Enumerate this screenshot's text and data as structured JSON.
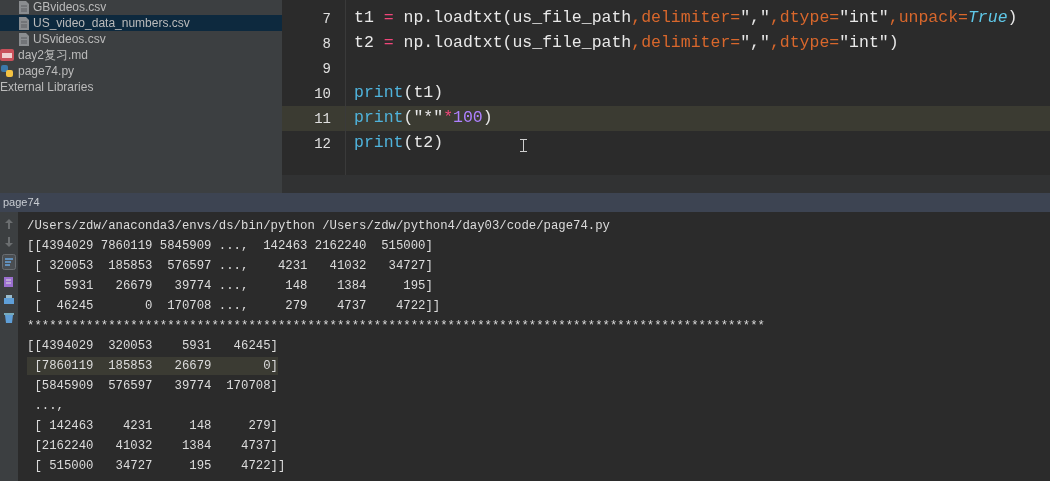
{
  "project_tree": {
    "folder_files": [
      {
        "label": "GBvideos.csv",
        "selected": false
      },
      {
        "label": "US_video_data_numbers.csv",
        "selected": true
      },
      {
        "label": "USvideos.csv",
        "selected": false
      }
    ],
    "files": [
      {
        "label": "day2复习.md",
        "kind": "markdown",
        "selected": false
      },
      {
        "label": "page74.py",
        "kind": "python",
        "selected": false
      }
    ],
    "root_items": [
      {
        "label": "External Libraries",
        "selected": false
      }
    ]
  },
  "editor": {
    "lines": [
      {
        "number": "7",
        "current": false,
        "tokens": [
          {
            "kind": "plain",
            "text": "t1 "
          },
          {
            "kind": "op",
            "text": "="
          },
          {
            "kind": "plain",
            "text": " np.loadtxt(us_file_path"
          },
          {
            "kind": "kwarg",
            "text": ",delimiter="
          },
          {
            "kind": "string",
            "text": "\",\""
          },
          {
            "kind": "kwarg",
            "text": ",dtype="
          },
          {
            "kind": "string",
            "text": "\"int\""
          },
          {
            "kind": "kwarg",
            "text": ",unpack="
          },
          {
            "kind": "keyword",
            "text": "True"
          },
          {
            "kind": "plain",
            "text": ")"
          }
        ]
      },
      {
        "number": "8",
        "current": false,
        "tokens": [
          {
            "kind": "plain",
            "text": "t2 "
          },
          {
            "kind": "op",
            "text": "="
          },
          {
            "kind": "plain",
            "text": " np.loadtxt(us_file_path"
          },
          {
            "kind": "kwarg",
            "text": ",delimiter="
          },
          {
            "kind": "string",
            "text": "\",\""
          },
          {
            "kind": "kwarg",
            "text": ",dtype="
          },
          {
            "kind": "string",
            "text": "\"int\""
          },
          {
            "kind": "plain",
            "text": ")"
          }
        ]
      },
      {
        "number": "9",
        "current": false
      },
      {
        "number": "10",
        "current": false,
        "tokens": [
          {
            "kind": "builtin",
            "text": "print"
          },
          {
            "kind": "plain",
            "text": "(t1)"
          }
        ]
      },
      {
        "number": "11",
        "current": true,
        "tokens": [
          {
            "kind": "builtin",
            "text": "print"
          },
          {
            "kind": "plain",
            "text": "("
          },
          {
            "kind": "string",
            "text": "\"*\""
          },
          {
            "kind": "op",
            "text": "*"
          },
          {
            "kind": "number",
            "text": "100"
          },
          {
            "kind": "plain",
            "text": ")"
          }
        ]
      },
      {
        "number": "12",
        "current": false,
        "tokens": [
          {
            "kind": "builtin",
            "text": "print"
          },
          {
            "kind": "plain",
            "text": "(t2)"
          }
        ]
      }
    ]
  },
  "run_panel": {
    "title": "page74",
    "output": [
      {
        "text": "/Users/zdw/anaconda3/envs/ds/bin/python /Users/zdw/python4/day03/code/page74.py",
        "selected": false
      },
      {
        "text": "[[4394029 7860119 5845909 ...,  142463 2162240  515000]",
        "selected": false
      },
      {
        "text": " [ 320053  185853  576597 ...,    4231   41032   34727]",
        "selected": false
      },
      {
        "text": " [   5931   26679   39774 ...,     148    1384     195]",
        "selected": false
      },
      {
        "text": " [  46245       0  170708 ...,     279    4737    4722]]",
        "selected": false
      },
      {
        "text": "****************************************************************************************************",
        "selected": false
      },
      {
        "text": "[[4394029  320053    5931   46245]",
        "selected": false
      },
      {
        "text": " [7860119  185853   26679       0]",
        "selected": true
      },
      {
        "text": " [5845909  576597   39774  170708]",
        "selected": false
      },
      {
        "text": " ...,",
        "selected": false
      },
      {
        "text": " [ 142463    4231     148     279]",
        "selected": false
      },
      {
        "text": " [2162240   41032    1384    4737]",
        "selected": false
      },
      {
        "text": " [ 515000   34727     195    4722]]",
        "selected": false
      }
    ]
  }
}
